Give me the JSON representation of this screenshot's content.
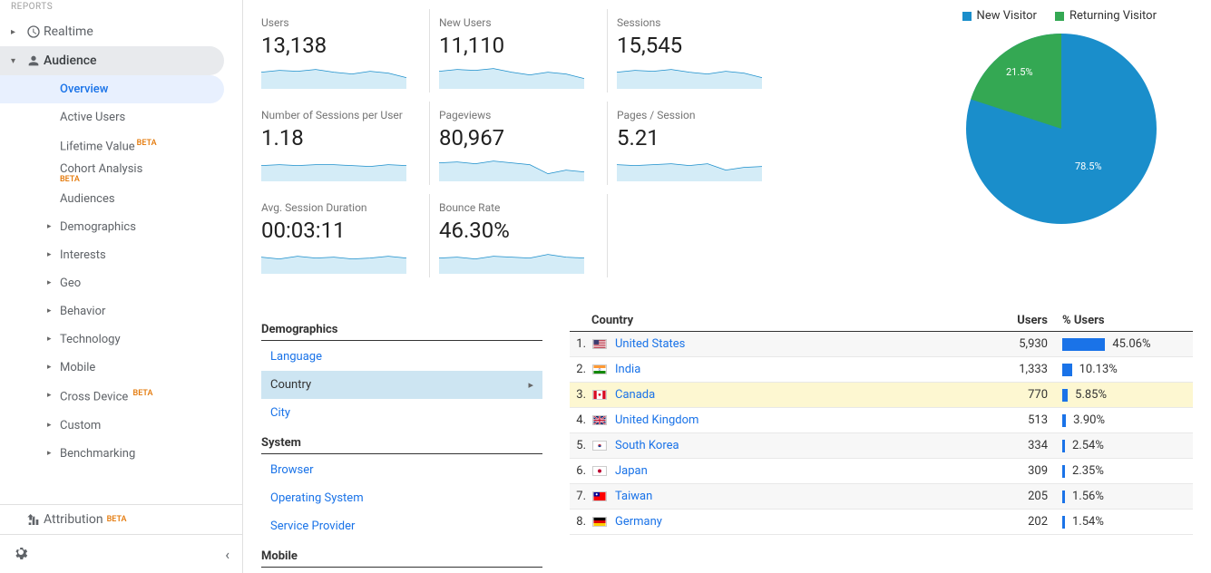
{
  "sidebar": {
    "section_label": "REPORTS",
    "realtime": "Realtime",
    "audience": "Audience",
    "sub": {
      "overview": "Overview",
      "active_users": "Active Users",
      "lifetime_value": "Lifetime Value",
      "cohort_analysis": "Cohort Analysis",
      "audiences": "Audiences",
      "demographics": "Demographics",
      "interests": "Interests",
      "geo": "Geo",
      "behavior": "Behavior",
      "technology": "Technology",
      "mobile": "Mobile",
      "cross_device": "Cross Device",
      "custom": "Custom",
      "benchmarking": "Benchmarking"
    },
    "attribution": "Attribution",
    "beta": "BETA"
  },
  "metrics": {
    "users": {
      "label": "Users",
      "value": "13,138"
    },
    "new_users": {
      "label": "New Users",
      "value": "11,110"
    },
    "sessions": {
      "label": "Sessions",
      "value": "15,545"
    },
    "sess_per_user": {
      "label": "Number of Sessions per User",
      "value": "1.18"
    },
    "pageviews": {
      "label": "Pageviews",
      "value": "80,967"
    },
    "pages_per_sess": {
      "label": "Pages / Session",
      "value": "5.21"
    },
    "avg_duration": {
      "label": "Avg. Session Duration",
      "value": "00:03:11"
    },
    "bounce_rate": {
      "label": "Bounce Rate",
      "value": "46.30%"
    }
  },
  "pie": {
    "legend_new": "New Visitor",
    "legend_ret": "Returning Visitor",
    "new_pct_label": "78.5%",
    "ret_pct_label": "21.5%",
    "color_new": "#1a8ecb",
    "color_ret": "#34a853"
  },
  "chart_data": {
    "type": "pie",
    "title": "",
    "series": [
      {
        "name": "New Visitor",
        "value": 78.5,
        "color": "#1a8ecb"
      },
      {
        "name": "Returning Visitor",
        "value": 21.5,
        "color": "#34a853"
      }
    ]
  },
  "dims": {
    "demographics_header": "Demographics",
    "language": "Language",
    "country": "Country",
    "city": "City",
    "system_header": "System",
    "browser": "Browser",
    "os": "Operating System",
    "service_provider": "Service Provider",
    "mobile_header": "Mobile"
  },
  "country_table": {
    "headers": {
      "country": "Country",
      "users": "Users",
      "pct_users": "% Users"
    },
    "rows": [
      {
        "rank": "1.",
        "name": "United States",
        "users": "5,930",
        "pct": "45.06%",
        "bar": 45.06,
        "flag": "us"
      },
      {
        "rank": "2.",
        "name": "India",
        "users": "1,333",
        "pct": "10.13%",
        "bar": 10.13,
        "flag": "in"
      },
      {
        "rank": "3.",
        "name": "Canada",
        "users": "770",
        "pct": "5.85%",
        "bar": 5.85,
        "flag": "ca",
        "highlight": true
      },
      {
        "rank": "4.",
        "name": "United Kingdom",
        "users": "513",
        "pct": "3.90%",
        "bar": 3.9,
        "flag": "gb"
      },
      {
        "rank": "5.",
        "name": "South Korea",
        "users": "334",
        "pct": "2.54%",
        "bar": 2.54,
        "flag": "kr"
      },
      {
        "rank": "6.",
        "name": "Japan",
        "users": "309",
        "pct": "2.35%",
        "bar": 2.35,
        "flag": "jp"
      },
      {
        "rank": "7.",
        "name": "Taiwan",
        "users": "205",
        "pct": "1.56%",
        "bar": 1.56,
        "flag": "tw"
      },
      {
        "rank": "8.",
        "name": "Germany",
        "users": "202",
        "pct": "1.54%",
        "bar": 1.54,
        "flag": "de"
      }
    ]
  }
}
